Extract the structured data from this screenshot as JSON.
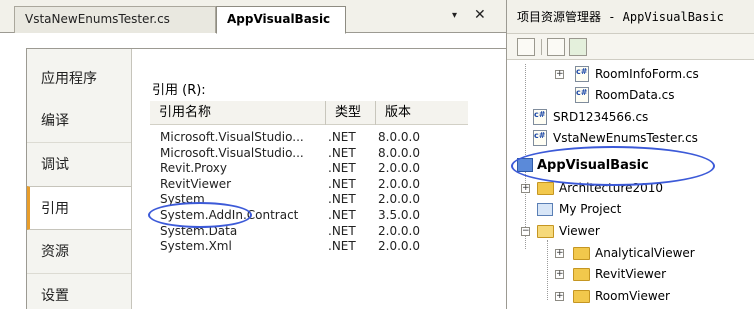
{
  "editor": {
    "tabs": [
      {
        "label": "VstaNewEnumsTester.cs",
        "active": false
      },
      {
        "label": "AppVisualBasic",
        "active": true
      }
    ],
    "dropdown_glyph": "▾",
    "close_glyph": "✕"
  },
  "designer": {
    "sidebar": [
      {
        "label": "应用程序",
        "selected": false
      },
      {
        "label": "编译",
        "selected": false
      },
      {
        "label": "调试",
        "selected": false
      },
      {
        "label": "引用",
        "selected": true
      },
      {
        "label": "资源",
        "selected": false
      },
      {
        "label": "设置",
        "selected": false
      }
    ],
    "references_label": "引用 (R):",
    "columns": {
      "name": "引用名称",
      "type": "类型",
      "version": "版本"
    },
    "rows": [
      {
        "name": "Microsoft.VisualStudio...",
        "type": ".NET",
        "version": "8.0.0.0"
      },
      {
        "name": "Microsoft.VisualStudio...",
        "type": ".NET",
        "version": "8.0.0.0"
      },
      {
        "name": "Revit.Proxy",
        "type": ".NET",
        "version": "2.0.0.0"
      },
      {
        "name": "RevitViewer",
        "type": ".NET",
        "version": "2.0.0.0"
      },
      {
        "name": "System",
        "type": ".NET",
        "version": "2.0.0.0"
      },
      {
        "name": "System.AddIn.Contract",
        "type": ".NET",
        "version": "3.5.0.0"
      },
      {
        "name": "System.Data",
        "type": ".NET",
        "version": "2.0.0.0"
      },
      {
        "name": "System.Xml",
        "type": ".NET",
        "version": "2.0.0.0"
      }
    ],
    "highlight_color": "#3c5ad8",
    "selected_accent": "#e89d2a"
  },
  "solution_explorer": {
    "title": "项目资源管理器 - AppVisualBasic",
    "toolbar_icons": [
      "properties-icon",
      "show-all-files-icon",
      "refresh-icon"
    ],
    "tree": [
      {
        "label": "RoomInfoForm.cs",
        "icon": "cs-file-icon",
        "expander": "+"
      },
      {
        "label": "RoomData.cs",
        "icon": "cs-file-icon",
        "expander": ""
      },
      {
        "label": "SRD1234566.cs",
        "icon": "cs-file-icon",
        "expander": ""
      },
      {
        "label": "VstaNewEnumsTester.cs",
        "icon": "cs-file-icon",
        "expander": ""
      },
      {
        "label": "AppVisualBasic",
        "icon": "vb-project-icon",
        "expander": "",
        "bold": true
      },
      {
        "label": "Architecture2010",
        "icon": "folder-icon",
        "expander": "+"
      },
      {
        "label": "My Project",
        "icon": "my-project-icon",
        "expander": ""
      },
      {
        "label": "Viewer",
        "icon": "open-folder-icon",
        "expander": "−"
      },
      {
        "label": "AnalyticalViewer",
        "icon": "folder-icon",
        "expander": "+"
      },
      {
        "label": "RevitViewer",
        "icon": "folder-icon",
        "expander": "+"
      },
      {
        "label": "RoomViewer",
        "icon": "folder-icon",
        "expander": "+"
      }
    ],
    "file_badge": "c#"
  }
}
